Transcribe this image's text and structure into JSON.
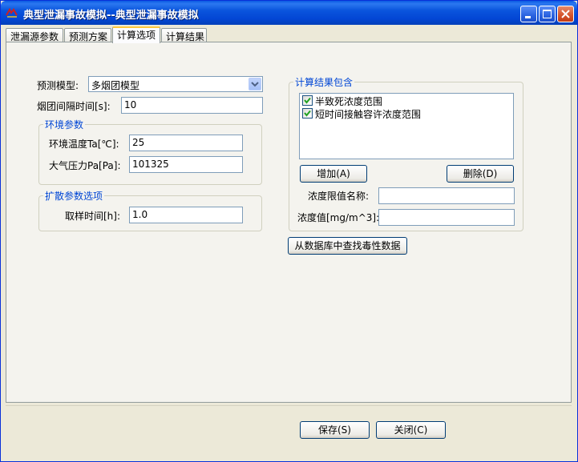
{
  "window": {
    "title": "典型泄漏事故模拟--典型泄漏事故模拟"
  },
  "tabs": [
    {
      "label": "泄漏源参数"
    },
    {
      "label": "预测方案"
    },
    {
      "label": "计算选项"
    },
    {
      "label": "计算结果"
    }
  ],
  "form": {
    "model_label": "预测模型:",
    "model_value": "多烟团模型",
    "interval_label": "烟团间隔时间[s]:",
    "interval_value": "10"
  },
  "env_group": {
    "title": "环境参数",
    "temp_label": "环境温度Ta[℃]:",
    "temp_value": "25",
    "pressure_label": "大气压力Pa[Pa]:",
    "pressure_value": "101325"
  },
  "diffusion_group": {
    "title": "扩散参数选项",
    "sample_label": "取样时间[h]:",
    "sample_value": "1.0"
  },
  "results_group": {
    "title": "计算结果包含",
    "items": [
      {
        "label": "半致死浓度范围",
        "checked": true
      },
      {
        "label": "短时间接触容许浓度范围",
        "checked": true
      }
    ],
    "add_button": "增加(A)",
    "delete_button": "删除(D)",
    "limit_name_label": "浓度限值名称:",
    "limit_name_value": "",
    "conc_label": "浓度值[mg/m^3]:",
    "conc_value": ""
  },
  "db_button": "从数据库中查找毒性数据",
  "footer": {
    "save_button": "保存(S)",
    "close_button": "关闭(C)"
  }
}
